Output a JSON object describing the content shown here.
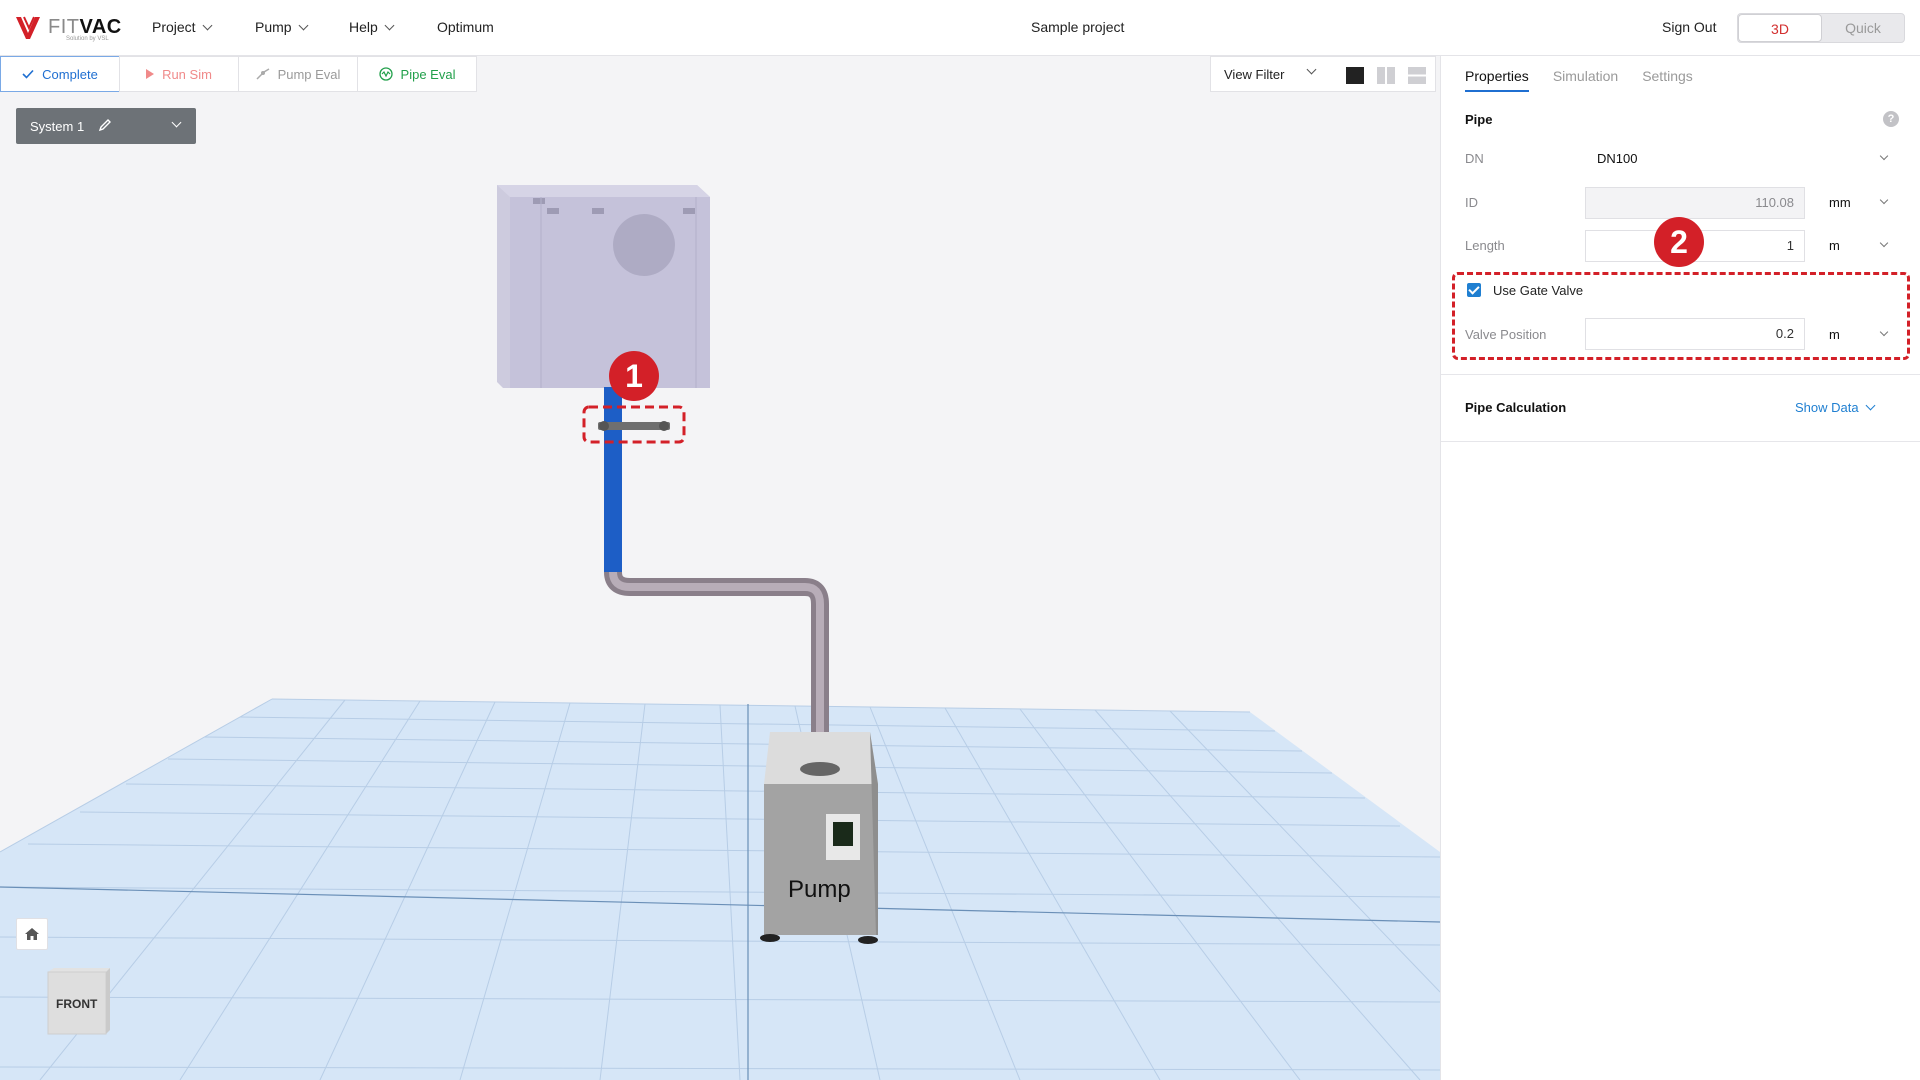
{
  "app": {
    "logo_main_a": "FIT",
    "logo_main_b": "VAC",
    "logo_sub": "Solution by VSL",
    "project_title": "Sample project",
    "sign_out": "Sign Out"
  },
  "menu": [
    {
      "label": "Project"
    },
    {
      "label": "Pump"
    },
    {
      "label": "Help"
    },
    {
      "label": "Optimum"
    }
  ],
  "view_toggle": {
    "mode_3d": "3D",
    "mode_quick": "Quick",
    "active": "3D"
  },
  "toolbar": {
    "complete": "Complete",
    "run_sim": "Run Sim",
    "pump_eval": "Pump Eval",
    "pipe_eval": "Pipe Eval",
    "view_filter": "View Filter"
  },
  "system": {
    "label": "System 1"
  },
  "scene": {
    "pump_label": "Pump",
    "cube_face": "FRONT"
  },
  "panel": {
    "tabs": [
      {
        "label": "Properties",
        "active": true
      },
      {
        "label": "Simulation",
        "active": false
      },
      {
        "label": "Settings",
        "active": false
      }
    ],
    "pipe_section": "Pipe",
    "dn_label": "DN",
    "dn_value": "DN100",
    "id_label": "ID",
    "id_value": "110.08",
    "id_unit": "mm",
    "length_label": "Length",
    "length_value": "1",
    "length_unit": "m",
    "use_gate_valve": "Use Gate Valve",
    "use_gate_valve_checked": true,
    "valve_position_label": "Valve Position",
    "valve_position_value": "0.2",
    "valve_position_unit": "m",
    "pipe_calc": "Pipe Calculation",
    "show_data": "Show Data"
  },
  "annotations": {
    "badge1": "1",
    "badge2": "2"
  },
  "colors": {
    "accent_blue": "#1f6fd1",
    "accent_red": "#d32028",
    "pipe_eval_green": "#22a04b"
  }
}
